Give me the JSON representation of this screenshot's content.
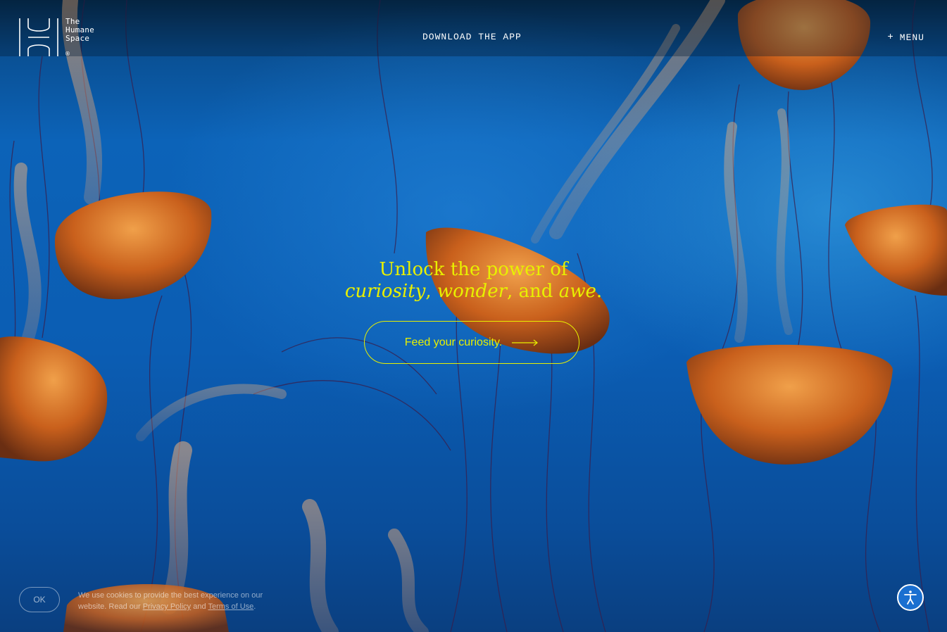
{
  "brand": {
    "name_lines": [
      "The",
      "Humane",
      "Space"
    ],
    "registered_mark": "®"
  },
  "nav": {
    "download_label": "DOWNLOAD THE APP",
    "menu_plus": "+",
    "menu_label": "MENU"
  },
  "hero": {
    "line1": "Unlock the power of",
    "word1": "curiosity",
    "sep1": ", ",
    "word2": "wonder",
    "sep2": ", and ",
    "word3": "awe",
    "end": ".",
    "cta_label": "Feed your curiosity."
  },
  "cookie": {
    "ok_label": "OK",
    "text_before": "We use cookies to provide the best experience on our website. Read our ",
    "privacy_link": "Privacy Policy",
    "and_text": " and ",
    "terms_link": "Terms of Use",
    "text_after": "."
  },
  "colors": {
    "accent": "#e8f000",
    "ocean": "#0b5db3",
    "jelly": "#d9782a"
  },
  "icons": {
    "logo": "humane-space-logo",
    "cta_arrow": "arrow-right-icon",
    "accessibility": "accessibility-icon"
  }
}
